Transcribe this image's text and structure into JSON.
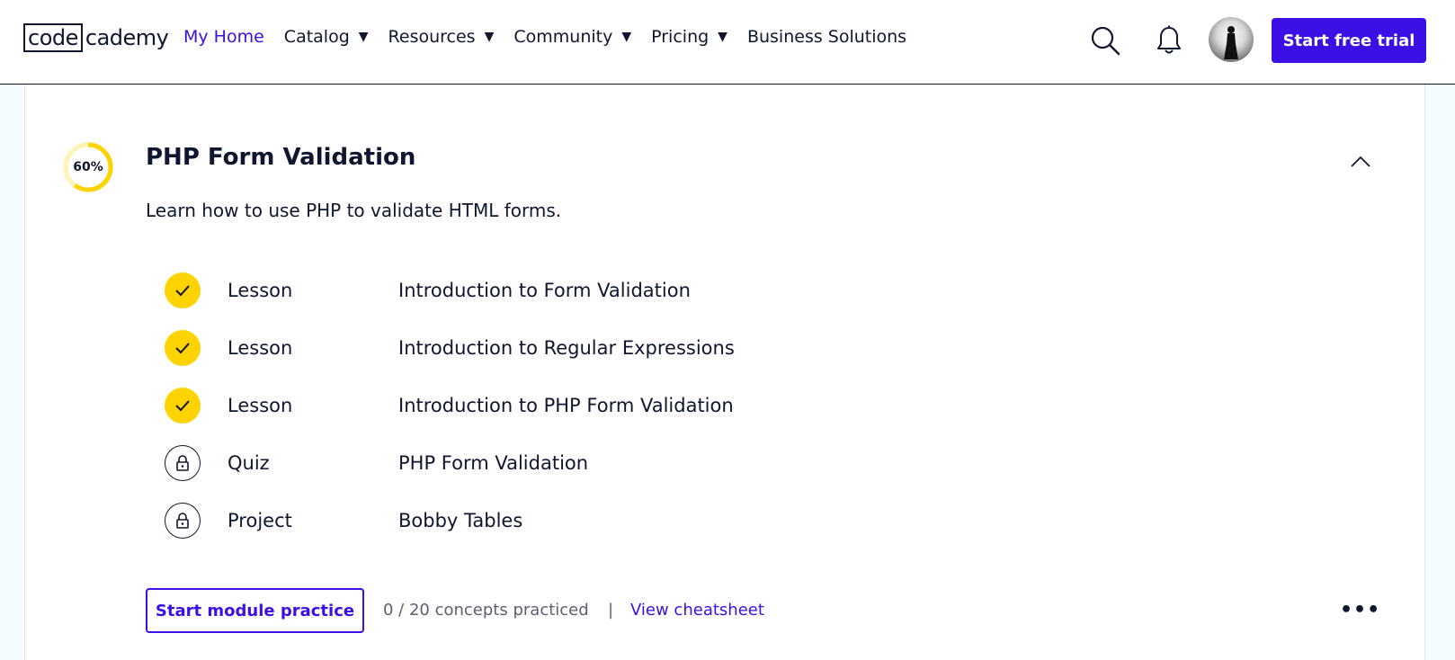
{
  "header": {
    "logo_boxed": "code",
    "logo_rest": "cademy",
    "nav": [
      {
        "label": "My Home",
        "dropdown": false,
        "active": true
      },
      {
        "label": "Catalog",
        "dropdown": true,
        "active": false
      },
      {
        "label": "Resources",
        "dropdown": true,
        "active": false
      },
      {
        "label": "Community",
        "dropdown": true,
        "active": false
      },
      {
        "label": "Pricing",
        "dropdown": true,
        "active": false
      },
      {
        "label": "Business Solutions",
        "dropdown": false,
        "active": false
      }
    ],
    "caret": "▼",
    "cta_label": "Start free trial"
  },
  "module": {
    "progress_label": "60%",
    "progress_fraction": 0.6,
    "title": "PHP Form Validation",
    "description": "Learn how to use PHP to validate HTML forms.",
    "items": [
      {
        "status": "completed",
        "type": "Lesson",
        "title": "Introduction to Form Validation"
      },
      {
        "status": "completed",
        "type": "Lesson",
        "title": "Introduction to Regular Expressions"
      },
      {
        "status": "completed",
        "type": "Lesson",
        "title": "Introduction to PHP Form Validation"
      },
      {
        "status": "locked",
        "type": "Quiz",
        "title": "PHP Form Validation"
      },
      {
        "status": "locked",
        "type": "Project",
        "title": "Bobby Tables"
      }
    ],
    "practice_button": "Start module practice",
    "concepts_text": "0 / 20 concepts practiced",
    "separator": "|",
    "cheatsheet_link": "View cheatsheet",
    "more_label": "•••"
  },
  "colors": {
    "accent": "#3a10e5",
    "progress": "#ffd300",
    "progress_track": "#fff3b8",
    "text": "#10162f"
  }
}
